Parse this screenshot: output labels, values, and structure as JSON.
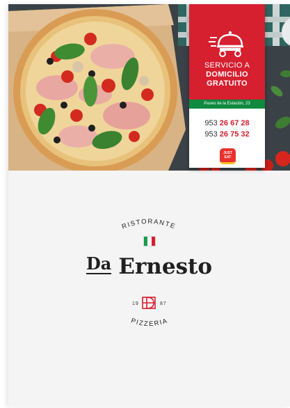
{
  "delivery_card": {
    "line1": "SERVICIO A",
    "line2": "DOMICILIO",
    "line3": "GRATUITO",
    "address": "Paseo de la Estación, 23",
    "phones": [
      {
        "prefix": "953",
        "number": "26 67 28"
      },
      {
        "prefix": "953",
        "number": "26 75 32"
      }
    ],
    "badge": {
      "line1": "JUST",
      "line2": "EAT"
    }
  },
  "logo": {
    "top_word": "RISTORANTE",
    "name_small": "Da",
    "name_large": "Ernesto",
    "year_left": "19",
    "year_right": "87",
    "bottom_word": "PIZZERIA",
    "flag_colors": [
      "#1a9a4a",
      "#ffffff",
      "#d61f2f"
    ]
  },
  "colors": {
    "brand_red": "#d61f2f",
    "brand_green": "#0f8a3e",
    "text_dark": "#202020"
  },
  "icons": [
    "delivery-cloche-scooter-icon",
    "just-eat-badge-icon",
    "italian-flag-icon",
    "ed-monogram-icon"
  ]
}
